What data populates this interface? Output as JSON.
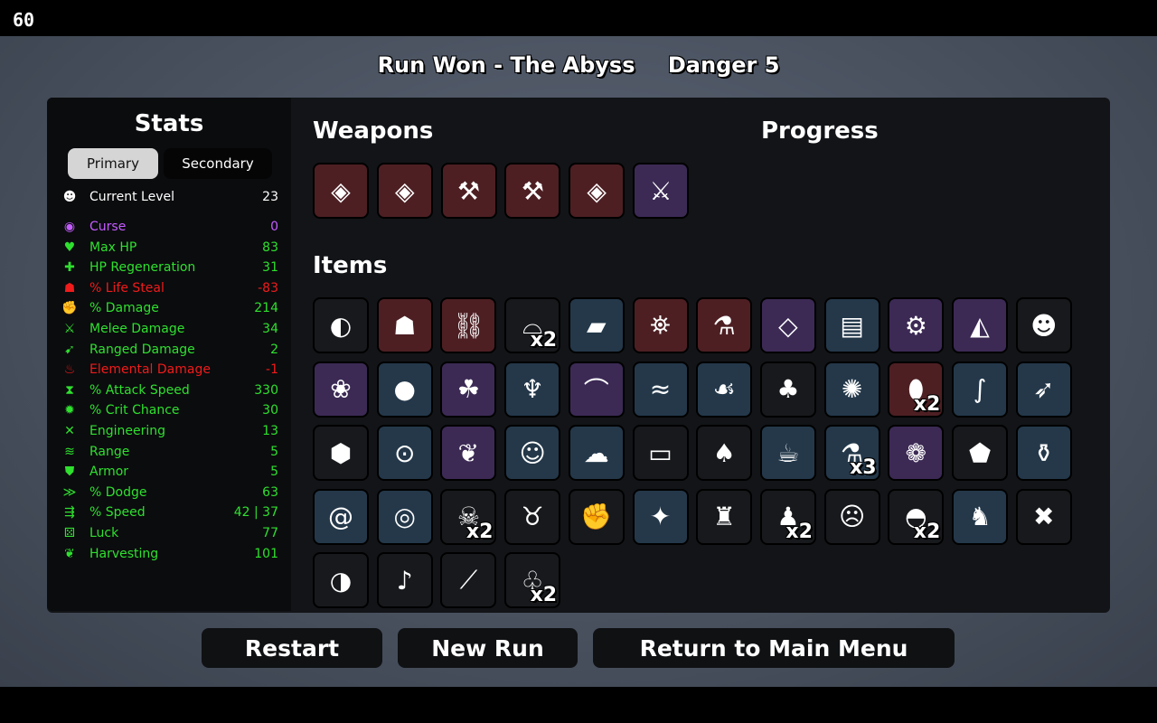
{
  "fps": "60",
  "header": {
    "run_result": "Run Won - The Abyss",
    "danger": "Danger 5"
  },
  "stats": {
    "title": "Stats",
    "tabs": {
      "primary": "Primary",
      "secondary": "Secondary"
    },
    "current_level": {
      "label": "Current Level",
      "value": "23",
      "color": "#ffffff",
      "icon": "level-icon"
    },
    "rows": [
      {
        "label": "Curse",
        "value": "0",
        "color": "#c45cff",
        "icon": "curse-icon",
        "glyph": "◉"
      },
      {
        "label": "Max HP",
        "value": "83",
        "color": "#2fe02f",
        "icon": "heart-icon",
        "glyph": "♥"
      },
      {
        "label": "HP Regeneration",
        "value": "31",
        "color": "#2fe02f",
        "icon": "regen-icon",
        "glyph": "✚"
      },
      {
        "label": "% Life Steal",
        "value": "-83",
        "color": "#f01b1b",
        "icon": "life-steal-icon",
        "glyph": "☗"
      },
      {
        "label": "% Damage",
        "value": "214",
        "color": "#2fe02f",
        "icon": "damage-icon",
        "glyph": "✊"
      },
      {
        "label": "Melee Damage",
        "value": "34",
        "color": "#2fe02f",
        "icon": "melee-icon",
        "glyph": "⚔"
      },
      {
        "label": "Ranged Damage",
        "value": "2",
        "color": "#2fe02f",
        "icon": "ranged-icon",
        "glyph": "➹"
      },
      {
        "label": "Elemental Damage",
        "value": "-1",
        "color": "#f01b1b",
        "icon": "elemental-icon",
        "glyph": "♨"
      },
      {
        "label": "% Attack Speed",
        "value": "330",
        "color": "#2fe02f",
        "icon": "attack-speed-icon",
        "glyph": "⧗"
      },
      {
        "label": "% Crit Chance",
        "value": "30",
        "color": "#2fe02f",
        "icon": "crit-icon",
        "glyph": "✹"
      },
      {
        "label": "Engineering",
        "value": "13",
        "color": "#2fe02f",
        "icon": "engineering-icon",
        "glyph": "✕"
      },
      {
        "label": "Range",
        "value": "5",
        "color": "#2fe02f",
        "icon": "range-icon",
        "glyph": "≋"
      },
      {
        "label": "Armor",
        "value": "5",
        "color": "#2fe02f",
        "icon": "armor-icon",
        "glyph": "⛊"
      },
      {
        "label": "% Dodge",
        "value": "63",
        "color": "#2fe02f",
        "icon": "dodge-icon",
        "glyph": "≫"
      },
      {
        "label": "% Speed",
        "value": "42 | 37",
        "color": "#2fe02f",
        "icon": "speed-icon",
        "glyph": "⇶"
      },
      {
        "label": "Luck",
        "value": "77",
        "color": "#2fe02f",
        "icon": "luck-icon",
        "glyph": "⚄"
      },
      {
        "label": "Harvesting",
        "value": "101",
        "color": "#2fe02f",
        "icon": "harvesting-icon",
        "glyph": "❦"
      }
    ]
  },
  "weapons": {
    "title": "Weapons",
    "list": [
      {
        "name": "spiked-shield-icon",
        "tier": "red",
        "glyph": "◈"
      },
      {
        "name": "spiked-shield-icon",
        "tier": "red",
        "glyph": "◈"
      },
      {
        "name": "axe-icon",
        "tier": "red",
        "glyph": "⚒"
      },
      {
        "name": "axe-icon",
        "tier": "red",
        "glyph": "⚒"
      },
      {
        "name": "spiked-shield-icon",
        "tier": "red",
        "glyph": "◈"
      },
      {
        "name": "sword-icon",
        "tier": "purple",
        "glyph": "⚔"
      }
    ]
  },
  "progress": {
    "title": "Progress"
  },
  "items": {
    "title": "Items",
    "list": [
      {
        "name": "alien-egg-icon",
        "tier": "black",
        "glyph": "◐",
        "count": ""
      },
      {
        "name": "red-cape-icon",
        "tier": "red",
        "glyph": "☗",
        "count": ""
      },
      {
        "name": "robot-spider-icon",
        "tier": "red",
        "glyph": "⛓",
        "count": ""
      },
      {
        "name": "propeller-hat-icon",
        "tier": "black",
        "glyph": "⌓",
        "count": "x2"
      },
      {
        "name": "plank-icon",
        "tier": "blue",
        "glyph": "▰",
        "count": ""
      },
      {
        "name": "lantern-icon",
        "tier": "red",
        "glyph": "⛯",
        "count": ""
      },
      {
        "name": "potion-tube-icon",
        "tier": "red",
        "glyph": "⚗",
        "count": ""
      },
      {
        "name": "mirror-icon",
        "tier": "purple",
        "glyph": "◇",
        "count": ""
      },
      {
        "name": "leather-vest-icon",
        "tier": "blue",
        "glyph": "▤",
        "count": ""
      },
      {
        "name": "wrench-icon",
        "tier": "purple",
        "glyph": "⚙",
        "count": ""
      },
      {
        "name": "shark-fin-icon",
        "tier": "purple",
        "glyph": "◭",
        "count": ""
      },
      {
        "name": "doll-head-icon",
        "tier": "black",
        "glyph": "☻",
        "count": ""
      },
      {
        "name": "white-mouse-icon",
        "tier": "purple",
        "glyph": "❀",
        "count": ""
      },
      {
        "name": "pearl-icon",
        "tier": "blue",
        "glyph": "●",
        "count": ""
      },
      {
        "name": "four-leaf-clover-icon",
        "tier": "purple",
        "glyph": "☘",
        "count": ""
      },
      {
        "name": "meat-hanger-icon",
        "tier": "blue",
        "glyph": "♆",
        "count": ""
      },
      {
        "name": "bowler-hat-icon",
        "tier": "purple",
        "glyph": "⌒",
        "count": ""
      },
      {
        "name": "claw-scratch-icon",
        "tier": "blue",
        "glyph": "≈",
        "count": ""
      },
      {
        "name": "blood-larva-icon",
        "tier": "blue",
        "glyph": "☙",
        "count": ""
      },
      {
        "name": "sprout-icon",
        "tier": "black",
        "glyph": "♣",
        "count": ""
      },
      {
        "name": "octopus-icon",
        "tier": "blue",
        "glyph": "✺",
        "count": ""
      },
      {
        "name": "golden-bean-icon",
        "tier": "red",
        "glyph": "⬮",
        "count": "x2"
      },
      {
        "name": "tentacle-icon",
        "tier": "blue",
        "glyph": "∫",
        "count": ""
      },
      {
        "name": "bullet-icon",
        "tier": "blue",
        "glyph": "➶",
        "count": ""
      },
      {
        "name": "coal-icon",
        "tier": "black",
        "glyph": "⬢",
        "count": ""
      },
      {
        "name": "spyglass-icon",
        "tier": "blue",
        "glyph": "⊙",
        "count": ""
      },
      {
        "name": "wheat-icon",
        "tier": "purple",
        "glyph": "❦",
        "count": ""
      },
      {
        "name": "frog-icon",
        "tier": "blue",
        "glyph": "☺",
        "count": ""
      },
      {
        "name": "alien-rock-icon",
        "tier": "blue",
        "glyph": "☁",
        "count": ""
      },
      {
        "name": "ticket-icon",
        "tier": "black",
        "glyph": "▭",
        "count": ""
      },
      {
        "name": "dead-tree-icon",
        "tier": "black",
        "glyph": "♠",
        "count": ""
      },
      {
        "name": "tea-cup-icon",
        "tier": "blue",
        "glyph": "☕",
        "count": ""
      },
      {
        "name": "green-flask-icon",
        "tier": "blue",
        "glyph": "⚗",
        "count": "x3"
      },
      {
        "name": "tardigrade-icon",
        "tier": "purple",
        "glyph": "❁",
        "count": ""
      },
      {
        "name": "fertilizer-bag-icon",
        "tier": "black",
        "glyph": "⬟",
        "count": ""
      },
      {
        "name": "round-flask-icon",
        "tier": "blue",
        "glyph": "⚱",
        "count": ""
      },
      {
        "name": "snail-icon",
        "tier": "blue",
        "glyph": "@",
        "count": ""
      },
      {
        "name": "red-ring-icon",
        "tier": "blue",
        "glyph": "◎",
        "count": ""
      },
      {
        "name": "skull-icon",
        "tier": "black",
        "glyph": "☠",
        "count": "x2"
      },
      {
        "name": "animal-skull-icon",
        "tier": "black",
        "glyph": "♉",
        "count": ""
      },
      {
        "name": "boxing-glove-icon",
        "tier": "black",
        "glyph": "✊",
        "count": ""
      },
      {
        "name": "wasp-icon",
        "tier": "blue",
        "glyph": "✦",
        "count": ""
      },
      {
        "name": "tooth-icon",
        "tier": "black",
        "glyph": "♜",
        "count": ""
      },
      {
        "name": "cap-mushroom-icon",
        "tier": "black",
        "glyph": "♟",
        "count": "x2"
      },
      {
        "name": "bandaged-face-icon",
        "tier": "black",
        "glyph": "☹",
        "count": ""
      },
      {
        "name": "beanie-icon",
        "tier": "black",
        "glyph": "◓",
        "count": "x2"
      },
      {
        "name": "rabbit-icon",
        "tier": "blue",
        "glyph": "♞",
        "count": ""
      },
      {
        "name": "meat-skewer-icon",
        "tier": "black",
        "glyph": "✖",
        "count": ""
      },
      {
        "name": "red-mouth-icon",
        "tier": "black",
        "glyph": "◑",
        "count": ""
      },
      {
        "name": "whistle-icon",
        "tier": "black",
        "glyph": "♪",
        "count": ""
      },
      {
        "name": "syringe-icon",
        "tier": "black",
        "glyph": "⟋",
        "count": ""
      },
      {
        "name": "tree-icon",
        "tier": "black",
        "glyph": "♧",
        "count": "x2"
      }
    ]
  },
  "buttons": {
    "restart": "Restart",
    "new_run": "New Run",
    "main_menu": "Return to Main Menu"
  },
  "colors": {
    "tier_black": "#17191c",
    "tier_blue": "#24384a",
    "tier_purple": "#3c2a55",
    "tier_red": "#4d1f23"
  }
}
